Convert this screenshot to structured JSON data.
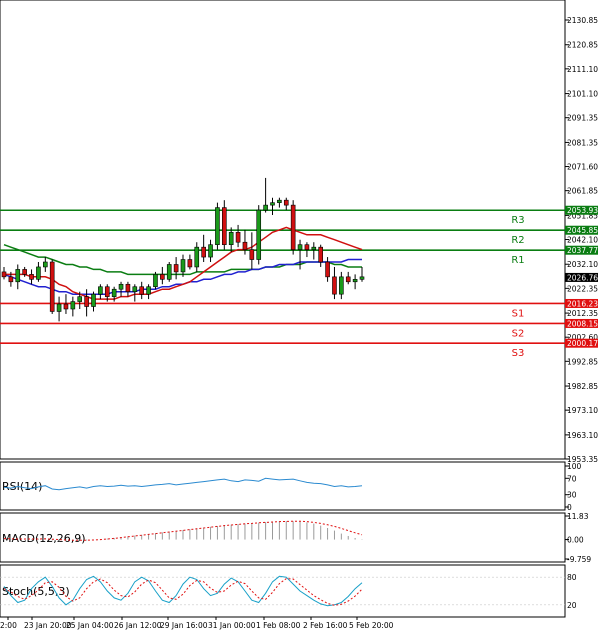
{
  "chart_data": {
    "type": "candlestick",
    "instrument_note": "",
    "price_axis": {
      "ticks": [
        "2130.85",
        "2120.85",
        "2111.10",
        "2101.10",
        "2091.35",
        "2081.35",
        "2071.60",
        "2061.85",
        "2051.85",
        "2042.10",
        "2032.10",
        "2022.35",
        "2012.35",
        "2002.60",
        "1992.85",
        "1982.85",
        "1973.10",
        "1963.10",
        "1953.35"
      ],
      "range": [
        1953.35,
        2130.85
      ]
    },
    "time_axis": {
      "labels": [
        "2:00",
        "23 Jan 20:00",
        "25 Jan 04:00",
        "26 Jan 12:00",
        "29 Jan 16:00",
        "31 Jan 00:00",
        "1 Feb 08:00",
        "2 Feb 16:00",
        "5 Feb 20:00"
      ]
    },
    "current_price": "2026.76",
    "levels": [
      {
        "name": "R3",
        "value": "2053.93",
        "color": "#0a7d12"
      },
      {
        "name": "R2",
        "value": "2045.85",
        "color": "#0a7d12"
      },
      {
        "name": "R1",
        "value": "2037.77",
        "color": "#0a7d12"
      },
      {
        "name": "S1",
        "value": "2016.23",
        "color": "#e01010"
      },
      {
        "name": "S2",
        "value": "2008.15",
        "color": "#e01010"
      },
      {
        "name": "S3",
        "value": "2000.17",
        "color": "#e01010"
      }
    ],
    "candles": [
      [
        2029,
        2031,
        2026,
        2027
      ],
      [
        2027,
        2029,
        2023,
        2025
      ],
      [
        2025,
        2032,
        2022,
        2030
      ],
      [
        2030,
        2031,
        2027,
        2028
      ],
      [
        2028,
        2030,
        2024,
        2026
      ],
      [
        2026,
        2033,
        2025,
        2031
      ],
      [
        2031,
        2035,
        2029,
        2033
      ],
      [
        2033,
        2034,
        2012,
        2013
      ],
      [
        2013,
        2019,
        2009,
        2016
      ],
      [
        2016,
        2020,
        2012,
        2014
      ],
      [
        2014,
        2019,
        2011,
        2017
      ],
      [
        2017,
        2021,
        2014,
        2019
      ],
      [
        2019,
        2022,
        2011,
        2015
      ],
      [
        2015,
        2021,
        2013,
        2020
      ],
      [
        2020,
        2024,
        2018,
        2023
      ],
      [
        2023,
        2024,
        2017,
        2019
      ],
      [
        2019,
        2023,
        2017,
        2022
      ],
      [
        2022,
        2025,
        2019,
        2024
      ],
      [
        2024,
        2025,
        2019,
        2021
      ],
      [
        2021,
        2024,
        2017,
        2023
      ],
      [
        2023,
        2025,
        2018,
        2020
      ],
      [
        2020,
        2024,
        2018,
        2023
      ],
      [
        2023,
        2029,
        2022,
        2028
      ],
      [
        2028,
        2031,
        2024,
        2026
      ],
      [
        2026,
        2033,
        2025,
        2032
      ],
      [
        2032,
        2035,
        2026,
        2029
      ],
      [
        2029,
        2036,
        2027,
        2034
      ],
      [
        2034,
        2036,
        2030,
        2031
      ],
      [
        2031,
        2041,
        2029,
        2039
      ],
      [
        2039,
        2044,
        2033,
        2035
      ],
      [
        2035,
        2042,
        2033,
        2040
      ],
      [
        2040,
        2057,
        2038,
        2055
      ],
      [
        2055,
        2058,
        2038,
        2040
      ],
      [
        2040,
        2047,
        2037,
        2045
      ],
      [
        2045,
        2048,
        2039,
        2041
      ],
      [
        2041,
        2046,
        2036,
        2038
      ],
      [
        2038,
        2045,
        2030,
        2034
      ],
      [
        2034,
        2056,
        2032,
        2054
      ],
      [
        2054,
        2067,
        2053,
        2056
      ],
      [
        2056,
        2059,
        2052,
        2057
      ],
      [
        2057,
        2059,
        2055,
        2058
      ],
      [
        2058,
        2059,
        2054,
        2056
      ],
      [
        2056,
        2058,
        2036,
        2038
      ],
      [
        2038,
        2042,
        2030,
        2040
      ],
      [
        2040,
        2041,
        2035,
        2038
      ],
      [
        2038,
        2041,
        2034,
        2039
      ],
      [
        2039,
        2040,
        2031,
        2033
      ],
      [
        2033,
        2035,
        2025,
        2027
      ],
      [
        2027,
        2031,
        2018,
        2020
      ],
      [
        2020,
        2029,
        2018,
        2027
      ],
      [
        2027,
        2029,
        2024,
        2025
      ],
      [
        2025,
        2028,
        2022,
        2026
      ],
      [
        2026,
        2031,
        2025,
        2027
      ]
    ],
    "moving_averages": [
      {
        "color": "#0a7d12",
        "values": [
          2040,
          2039,
          2038,
          2037,
          2036,
          2035,
          2035,
          2034,
          2033,
          2032,
          2032,
          2031,
          2031,
          2030,
          2030,
          2029,
          2029,
          2029,
          2028,
          2028,
          2028,
          2028,
          2028,
          2028,
          2028,
          2028,
          2028,
          2028,
          2029,
          2029,
          2029,
          2029,
          2029,
          2030,
          2030,
          2030,
          2030,
          2030,
          2031,
          2031,
          2031,
          2032,
          2032,
          2032,
          2033,
          2033,
          2033,
          2033,
          2032,
          2032,
          2031,
          2031,
          2031
        ]
      },
      {
        "color": "#2020d0",
        "values": [
          2028,
          2027,
          2026,
          2025,
          2024,
          2023,
          2023,
          2022,
          2021,
          2021,
          2020,
          2020,
          2020,
          2020,
          2020,
          2020,
          2021,
          2021,
          2021,
          2021,
          2022,
          2022,
          2022,
          2023,
          2023,
          2024,
          2024,
          2025,
          2025,
          2026,
          2026,
          2027,
          2028,
          2028,
          2029,
          2029,
          2030,
          2030,
          2031,
          2031,
          2032,
          2032,
          2032,
          2033,
          2033,
          2033,
          2033,
          2033,
          2033,
          2033,
          2034,
          2034,
          2034
        ]
      },
      {
        "color": "#d01010",
        "values": [
          2028,
          2028,
          2028,
          2028,
          2027,
          2027,
          2027,
          2026,
          2024,
          2023,
          2021,
          2020,
          2019,
          2018,
          2018,
          2018,
          2018,
          2019,
          2019,
          2020,
          2020,
          2020,
          2021,
          2022,
          2022,
          2023,
          2024,
          2025,
          2027,
          2029,
          2031,
          2033,
          2035,
          2037,
          2038,
          2038,
          2039,
          2041,
          2043,
          2045,
          2046,
          2047,
          2046,
          2045,
          2044,
          2044,
          2044,
          2043,
          2042,
          2041,
          2040,
          2039,
          2038
        ]
      }
    ],
    "rsi": {
      "label": "RSI(14)",
      "ticks": [
        "100",
        "70",
        "30",
        "0"
      ],
      "values": [
        48,
        46,
        50,
        47,
        45,
        49,
        52,
        44,
        42,
        45,
        47,
        49,
        46,
        50,
        52,
        50,
        51,
        53,
        51,
        52,
        50,
        52,
        54,
        55,
        57,
        54,
        56,
        58,
        60,
        62,
        64,
        66,
        68,
        64,
        62,
        66,
        65,
        63,
        70,
        68,
        66,
        67,
        68,
        64,
        60,
        58,
        57,
        54,
        50,
        52,
        49,
        50,
        52
      ]
    },
    "macd": {
      "label": "MACD(12,26,9)",
      "ticks": [
        "11.83",
        "0.00",
        "-9.759"
      ],
      "histogram": [
        0.5,
        0.2,
        0.1,
        0.3,
        0.2,
        0.4,
        0.6,
        -0.5,
        -1.0,
        -0.8,
        -0.6,
        -0.4,
        -0.5,
        -0.2,
        0.2,
        0.5,
        0.8,
        1.2,
        1.6,
        2.0,
        2.4,
        2.8,
        3.2,
        3.6,
        4.0,
        4.4,
        4.8,
        5.2,
        5.6,
        6.0,
        6.4,
        6.8,
        7.2,
        7.5,
        7.8,
        8.0,
        8.2,
        8.5,
        8.8,
        9.0,
        9.2,
        9.3,
        9.2,
        9.0,
        8.6,
        8.0,
        7.0,
        5.8,
        4.5,
        3.0,
        1.8,
        0.8,
        0.2
      ],
      "signal": [
        0.5,
        0.4,
        0.3,
        0.3,
        0.3,
        0.3,
        0.4,
        0.2,
        0.0,
        -0.2,
        -0.3,
        -0.3,
        -0.3,
        -0.2,
        0.0,
        0.3,
        0.6,
        1.0,
        1.4,
        1.8,
        2.2,
        2.6,
        3.0,
        3.4,
        3.8,
        4.2,
        4.6,
        5.0,
        5.4,
        5.8,
        6.2,
        6.6,
        7.0,
        7.3,
        7.6,
        7.9,
        8.1,
        8.4,
        8.6,
        8.8,
        9.0,
        9.1,
        9.2,
        9.2,
        9.0,
        8.6,
        8.1,
        7.4,
        6.6,
        5.6,
        4.5,
        3.4,
        2.4
      ]
    },
    "stoch": {
      "label": "Stoch(5,5,3)",
      "ticks": [
        "80",
        "20"
      ],
      "k": [
        60,
        40,
        25,
        30,
        55,
        70,
        80,
        60,
        35,
        20,
        30,
        55,
        75,
        82,
        70,
        50,
        35,
        30,
        45,
        70,
        80,
        72,
        50,
        30,
        25,
        40,
        65,
        80,
        75,
        55,
        40,
        45,
        65,
        78,
        70,
        50,
        30,
        25,
        45,
        70,
        82,
        80,
        65,
        50,
        40,
        30,
        22,
        18,
        20,
        25,
        38,
        55,
        68
      ],
      "d": [
        55,
        48,
        38,
        32,
        40,
        52,
        68,
        70,
        58,
        38,
        28,
        35,
        55,
        70,
        76,
        68,
        52,
        40,
        37,
        48,
        65,
        74,
        68,
        52,
        35,
        32,
        43,
        62,
        73,
        70,
        56,
        47,
        50,
        63,
        71,
        66,
        50,
        35,
        32,
        47,
        66,
        77,
        76,
        64,
        52,
        40,
        31,
        23,
        19,
        21,
        28,
        39,
        54
      ]
    }
  }
}
